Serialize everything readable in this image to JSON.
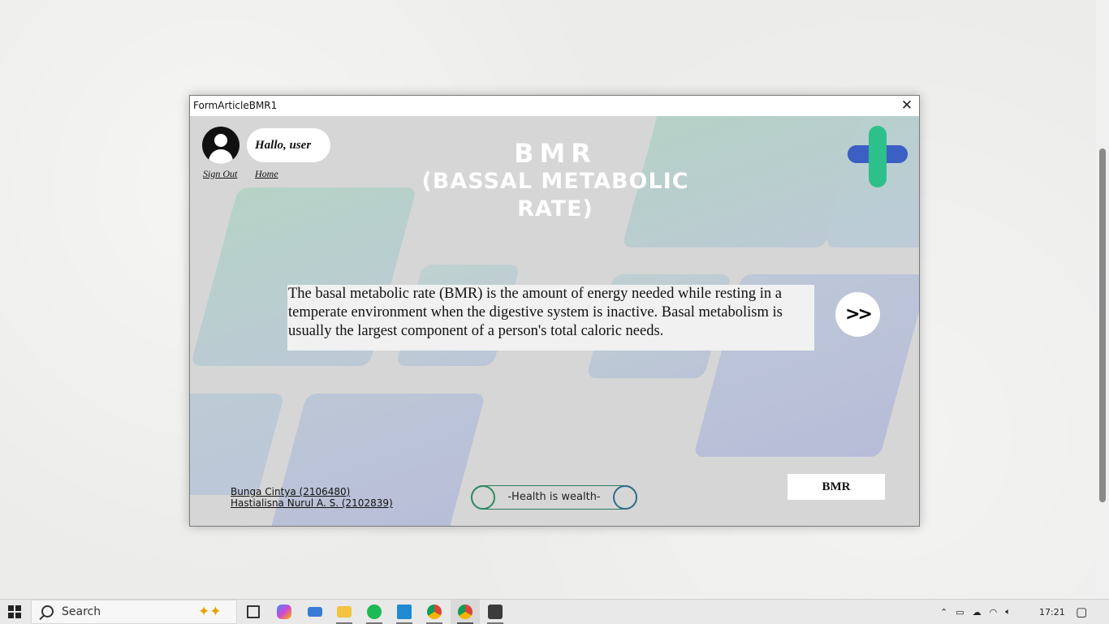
{
  "window": {
    "title": "FormArticleBMR1",
    "close_label": "✕"
  },
  "header": {
    "greeting": "Hallo, user",
    "signout_label": "Sign Out",
    "home_label": "Home",
    "title_line1": "BMR",
    "title_line2": "(BASSAL METABOLIC RATE)"
  },
  "article": {
    "text": "The basal metabolic rate (BMR) is the amount of energy needed while resting in a temperate environment when the digestive system is inactive.  Basal metabolism is usually the largest component of a person's total caloric needs."
  },
  "next_label": ">>",
  "credits": [
    "Bunga Cintya (2106480)",
    "Hastialisna Nurul A. S. (2102839)"
  ],
  "motto": "-Health is wealth-",
  "bmr_button_label": "BMR",
  "taskbar": {
    "search_placeholder": "Search",
    "time": "17:21"
  },
  "colors": {
    "client_bg": "#d6d6d6",
    "logo_green": "#2ec08a",
    "logo_blue": "#3c5fc4"
  }
}
